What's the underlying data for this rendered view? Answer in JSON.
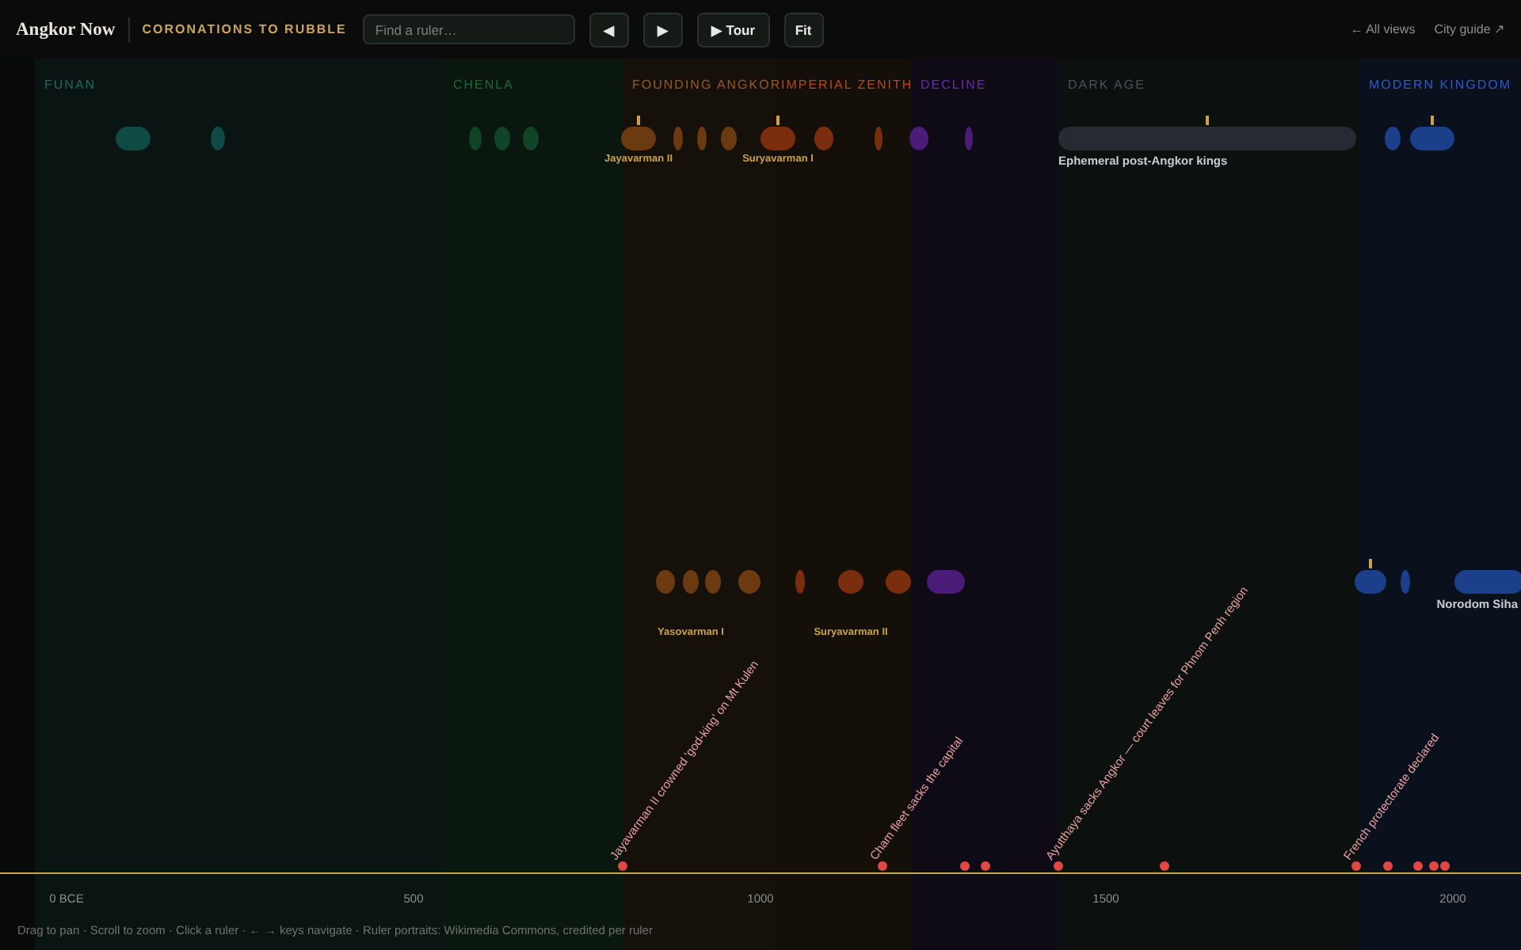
{
  "header": {
    "logo": "Angkor Now",
    "title": "CORONATIONS TO RUBBLE",
    "search": {
      "placeholder": "Find a ruler…"
    },
    "buttons": [
      "◀",
      "▶",
      "▶ Tour",
      "Fit"
    ],
    "links": [
      "← All views",
      "City guide ↗"
    ]
  },
  "eras": [
    {
      "name": "FUNAN",
      "color": "#1a6b63",
      "rulers": [
        {
          "tick": false
        },
        {
          "tick": false
        }
      ]
    },
    {
      "name": "CHENLA",
      "color": "#1a6b3a",
      "rulers": [
        {
          "tick": false
        },
        {
          "tick": false
        },
        {
          "tick": false
        }
      ]
    },
    {
      "name": "FOUNDING ANGKOR",
      "color": "#9a5a1e",
      "rulers": [
        {
          "tick": true,
          "label": "Jayavarman II"
        },
        {
          "tick": false
        },
        {
          "tick": false
        },
        {
          "tick": false
        },
        {
          "tick": false
        },
        {
          "tick": false,
          "label": "Yasovarman I"
        },
        {
          "tick": false
        },
        {
          "tick": false
        }
      ]
    },
    {
      "name": "IMPERIAL ZENITH",
      "color": "#b8481a",
      "rulers": [
        {
          "tick": true,
          "label": "Suryavarman I"
        },
        {
          "tick": false
        },
        {
          "tick": false
        },
        {
          "tick": false
        },
        {
          "tick": false,
          "label": "Suryavarman II"
        },
        {
          "tick": false
        }
      ]
    },
    {
      "name": "DECLINE",
      "color": "#6a2bb0",
      "rulers": [
        {
          "tick": false
        },
        {
          "tick": false
        },
        {
          "tick": false
        }
      ]
    },
    {
      "name": "DARK AGE",
      "color": "#4a525c",
      "rulers": [
        {
          "tick": true,
          "label": "Ephemeral post-Angkor kings"
        }
      ]
    },
    {
      "name": "MODERN KINGDOM",
      "color": "#2b5ad0",
      "rulers": [
        {
          "tick": false
        },
        {
          "tick": true
        },
        {
          "tick": true
        },
        {
          "tick": false
        },
        {
          "tick": false,
          "label": "Norodom Siha"
        }
      ]
    }
  ],
  "events": [
    {
      "kind": "labeled",
      "label": "Jayavarman II crowned 'god-king' on Mt Kulen"
    },
    {
      "kind": "labeled",
      "label": "Cham fleet sacks the capital"
    },
    {
      "kind": "dot"
    },
    {
      "kind": "dot"
    },
    {
      "kind": "labeled",
      "label": "Ayutthaya sacks Angkor — court leaves for Phnom Penh region"
    },
    {
      "kind": "dot"
    },
    {
      "kind": "labeled",
      "label": "French protectorate declared"
    },
    {
      "kind": "dot"
    },
    {
      "kind": "dot"
    },
    {
      "kind": "dot"
    },
    {
      "kind": "dot"
    }
  ],
  "axis_ticks": [
    "0 BCE",
    "500",
    "1000",
    "1500",
    "2000"
  ],
  "footer": "Drag to pan · Scroll to zoom · Click a ruler · ← → keys navigate · Ruler portraits: Wikimedia Commons, credited per ruler"
}
